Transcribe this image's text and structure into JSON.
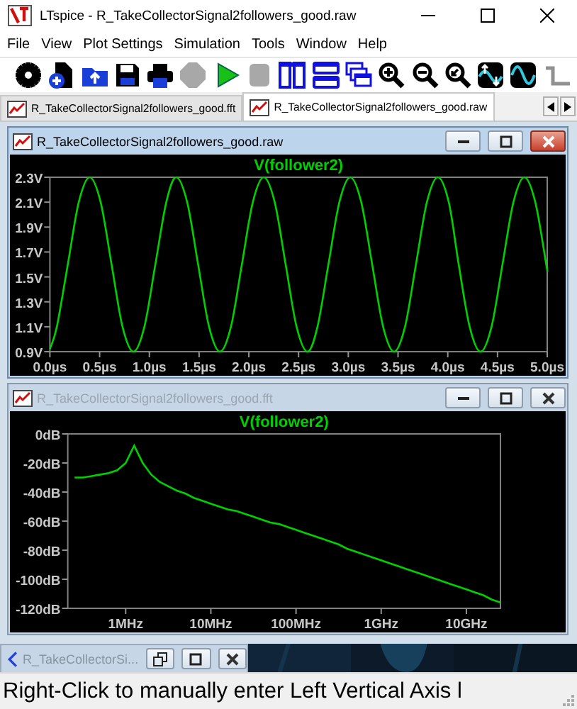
{
  "window": {
    "title": "LTspice - R_TakeCollectorSignal2followers_good.raw"
  },
  "menu": [
    "File",
    "View",
    "Plot Settings",
    "Simulation",
    "Tools",
    "Window",
    "Help"
  ],
  "toolbar": [
    {
      "kind": "settings",
      "disabled": false
    },
    {
      "kind": "new",
      "disabled": false
    },
    {
      "kind": "open",
      "disabled": false
    },
    {
      "kind": "save",
      "disabled": false
    },
    {
      "kind": "print",
      "disabled": false
    },
    {
      "kind": "halt",
      "disabled": true
    },
    {
      "kind": "run",
      "disabled": false
    },
    {
      "kind": "stop",
      "disabled": true
    },
    {
      "kind": "tile-vertical",
      "disabled": false
    },
    {
      "kind": "tile-horizontal",
      "disabled": false
    },
    {
      "kind": "cascade",
      "disabled": false
    },
    {
      "kind": "zoom-in",
      "disabled": false
    },
    {
      "kind": "zoom-out",
      "disabled": false
    },
    {
      "kind": "zoom-fit",
      "disabled": false
    },
    {
      "kind": "autoscale",
      "disabled": false
    },
    {
      "kind": "wave",
      "disabled": false
    },
    {
      "kind": "wire",
      "disabled": false
    }
  ],
  "tabs": [
    {
      "label": "R_TakeCollectorSignal2followers_good.fft",
      "selected": false
    },
    {
      "label": "R_TakeCollectorSignal2followers_good.raw",
      "selected": true
    }
  ],
  "plot_windows": [
    {
      "title": "R_TakeCollectorSignal2followers_good.raw",
      "active": true,
      "chart_data": {
        "type": "line",
        "title": "V(follower2)",
        "x": [
          0,
          0.07,
          0.18,
          0.29,
          0.4,
          0.51,
          0.62,
          0.73,
          0.84,
          0.95,
          1.06,
          1.17,
          1.27,
          1.38,
          1.49,
          1.6,
          1.71,
          1.82,
          1.93,
          2.04,
          2.15,
          2.26,
          2.37,
          2.48,
          2.59,
          2.69,
          2.8,
          2.91,
          3.02,
          3.13,
          3.24,
          3.35,
          3.46,
          3.57,
          3.68,
          3.79,
          3.9,
          4.01,
          4.11,
          4.22,
          4.33,
          4.44,
          4.55,
          4.66,
          4.77,
          4.88,
          4.99,
          5.0
        ],
        "series": [
          {
            "color": "#00d000",
            "values": [
              0.92,
              1.1,
              1.6,
              2.1,
              2.3,
              2.1,
              1.6,
              1.1,
              0.9,
              1.1,
              1.6,
              2.1,
              2.3,
              2.1,
              1.6,
              1.1,
              0.9,
              1.1,
              1.6,
              2.1,
              2.3,
              2.1,
              1.6,
              1.1,
              0.9,
              1.1,
              1.6,
              2.1,
              2.3,
              2.1,
              1.6,
              1.1,
              0.9,
              1.1,
              1.6,
              2.1,
              2.3,
              2.1,
              1.6,
              1.1,
              0.9,
              1.1,
              1.6,
              2.1,
              2.3,
              2.1,
              1.6,
              1.55
            ]
          }
        ],
        "xlim": [
          0,
          5
        ],
        "ylim": [
          0.9,
          2.3
        ],
        "xticks": [
          {
            "value": 0,
            "label": "0.0µs"
          },
          {
            "value": 0.5,
            "label": "0.5µs"
          },
          {
            "value": 1,
            "label": "1.0µs"
          },
          {
            "value": 1.5,
            "label": "1.5µs"
          },
          {
            "value": 2,
            "label": "2.0µs"
          },
          {
            "value": 2.5,
            "label": "2.5µs"
          },
          {
            "value": 3,
            "label": "3.0µs"
          },
          {
            "value": 3.5,
            "label": "3.5µs"
          },
          {
            "value": 4,
            "label": "4.0µs"
          },
          {
            "value": 4.5,
            "label": "4.5µs"
          },
          {
            "value": 5,
            "label": "5.0µs"
          }
        ],
        "yticks": [
          {
            "value": 2.3,
            "label": "2.3V"
          },
          {
            "value": 2.1,
            "label": "2.1V"
          },
          {
            "value": 1.9,
            "label": "1.9V"
          },
          {
            "value": 1.7,
            "label": "1.7V"
          },
          {
            "value": 1.5,
            "label": "1.5V"
          },
          {
            "value": 1.3,
            "label": "1.3V"
          },
          {
            "value": 1.1,
            "label": "1.1V"
          },
          {
            "value": 0.9,
            "label": "0.9V"
          }
        ]
      }
    },
    {
      "title": "R_TakeCollectorSignal2followers_good.fft",
      "active": false,
      "chart_data": {
        "type": "line",
        "title": "V(follower2)",
        "categories": [
          null,
          null,
          null,
          null,
          null,
          null,
          "1MHz",
          null,
          null,
          null,
          null,
          null,
          null,
          null,
          null,
          null,
          "10MHz",
          null,
          null,
          null,
          null,
          null,
          null,
          null,
          null,
          null,
          "100MHz",
          null,
          null,
          null,
          null,
          null,
          null,
          null,
          null,
          null,
          "1GHz",
          null,
          null,
          null,
          null,
          null,
          null,
          null,
          null,
          null,
          "10GHz",
          null,
          null,
          null,
          null
        ],
        "series": [
          {
            "color": "#00d000",
            "values": [
              -30,
              -30,
              -29,
              -28,
              -27,
              -25,
              -20,
              -8,
              -20,
              -28,
              -33,
              -36,
              -39,
              -41,
              -44,
              -46,
              -48,
              -50,
              -52,
              -53,
              -55,
              -57,
              -59,
              -61,
              -62,
              -64,
              -66,
              -68,
              -70,
              -72,
              -74,
              -76,
              -79,
              -81,
              -83,
              -85,
              -87,
              -89,
              -91,
              -93,
              -95,
              -97,
              -99,
              -101,
              -103,
              -105,
              -107,
              -109,
              -111,
              -114,
              -116
            ]
          }
        ],
        "ylim": [
          -120,
          0
        ],
        "yticks": [
          {
            "value": 0,
            "label": "0dB"
          },
          {
            "value": -20,
            "label": "-20dB"
          },
          {
            "value": -40,
            "label": "-40dB"
          },
          {
            "value": -60,
            "label": "-60dB"
          },
          {
            "value": -80,
            "label": "-80dB"
          },
          {
            "value": -100,
            "label": "-100dB"
          },
          {
            "value": -120,
            "label": "-120dB"
          }
        ]
      }
    }
  ],
  "minimized_window": {
    "title": "R_TakeCollectorSi..."
  },
  "status_bar": "Right-Click to manually enter Left Vertical Axis l"
}
